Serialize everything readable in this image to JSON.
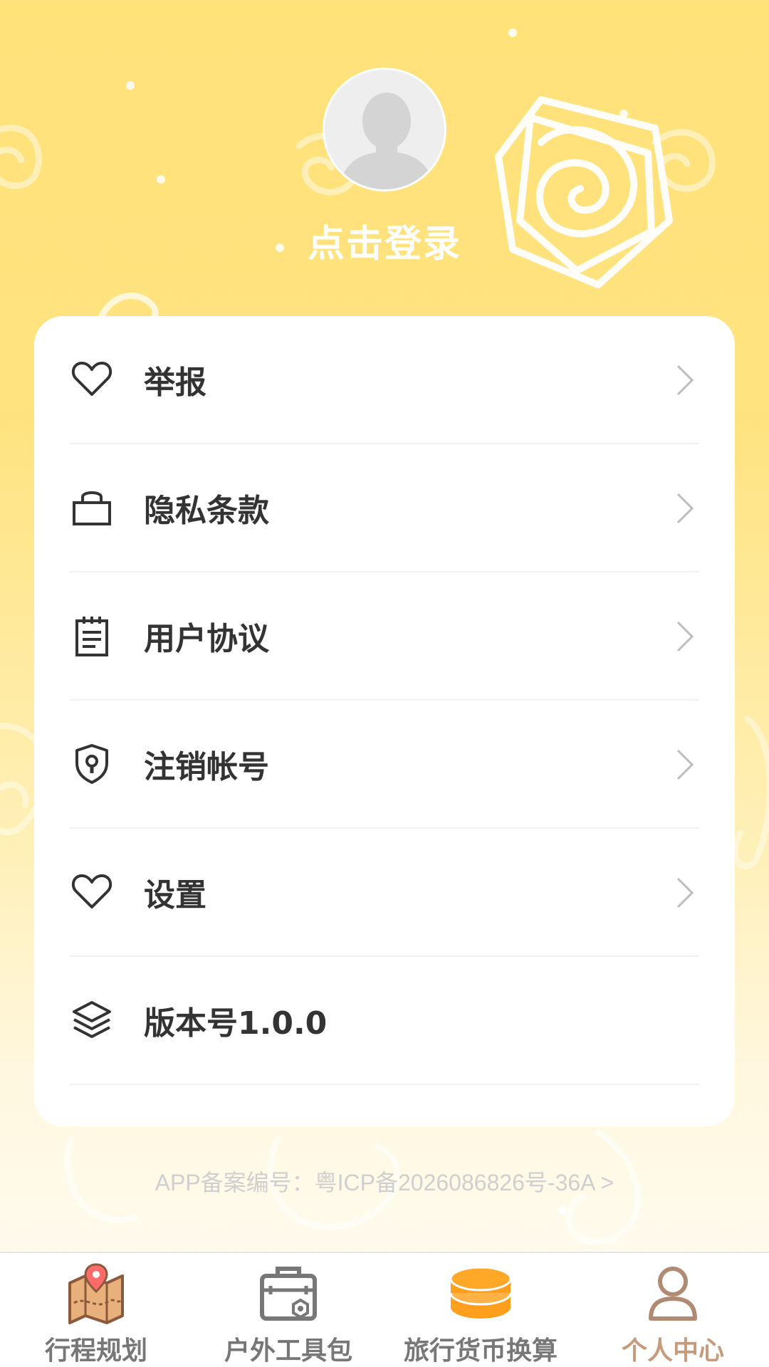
{
  "profile": {
    "avatar_icon": "default-user-avatar",
    "login_label": "点击登录"
  },
  "menu": {
    "items": [
      {
        "label": "举报",
        "icon": "heart-icon"
      },
      {
        "label": "隐私条款",
        "icon": "bag-icon"
      },
      {
        "label": "用户协议",
        "icon": "notepad-icon"
      },
      {
        "label": "注销帐号",
        "icon": "shield-keyhole-icon"
      },
      {
        "label": "设置",
        "icon": "heart-icon"
      },
      {
        "label": "版本号1.0.0",
        "icon": "layers-icon"
      }
    ]
  },
  "footer": {
    "icp_text": "APP备案编号：粤ICP备2026086826号-36A >"
  },
  "tabbar": {
    "tabs": [
      {
        "label": "行程规划",
        "icon": "map-pin-icon",
        "active": false
      },
      {
        "label": "户外工具包",
        "icon": "toolkit-icon",
        "active": false
      },
      {
        "label": "旅行货币换算",
        "icon": "coins-icon",
        "active": false
      },
      {
        "label": "个人中心",
        "icon": "person-icon",
        "active": true
      }
    ]
  },
  "colors": {
    "background_top": "#ffe27a",
    "active_tab": "#c89a7c",
    "inactive_tab": "#777777",
    "coins": "#ff9f1c"
  }
}
